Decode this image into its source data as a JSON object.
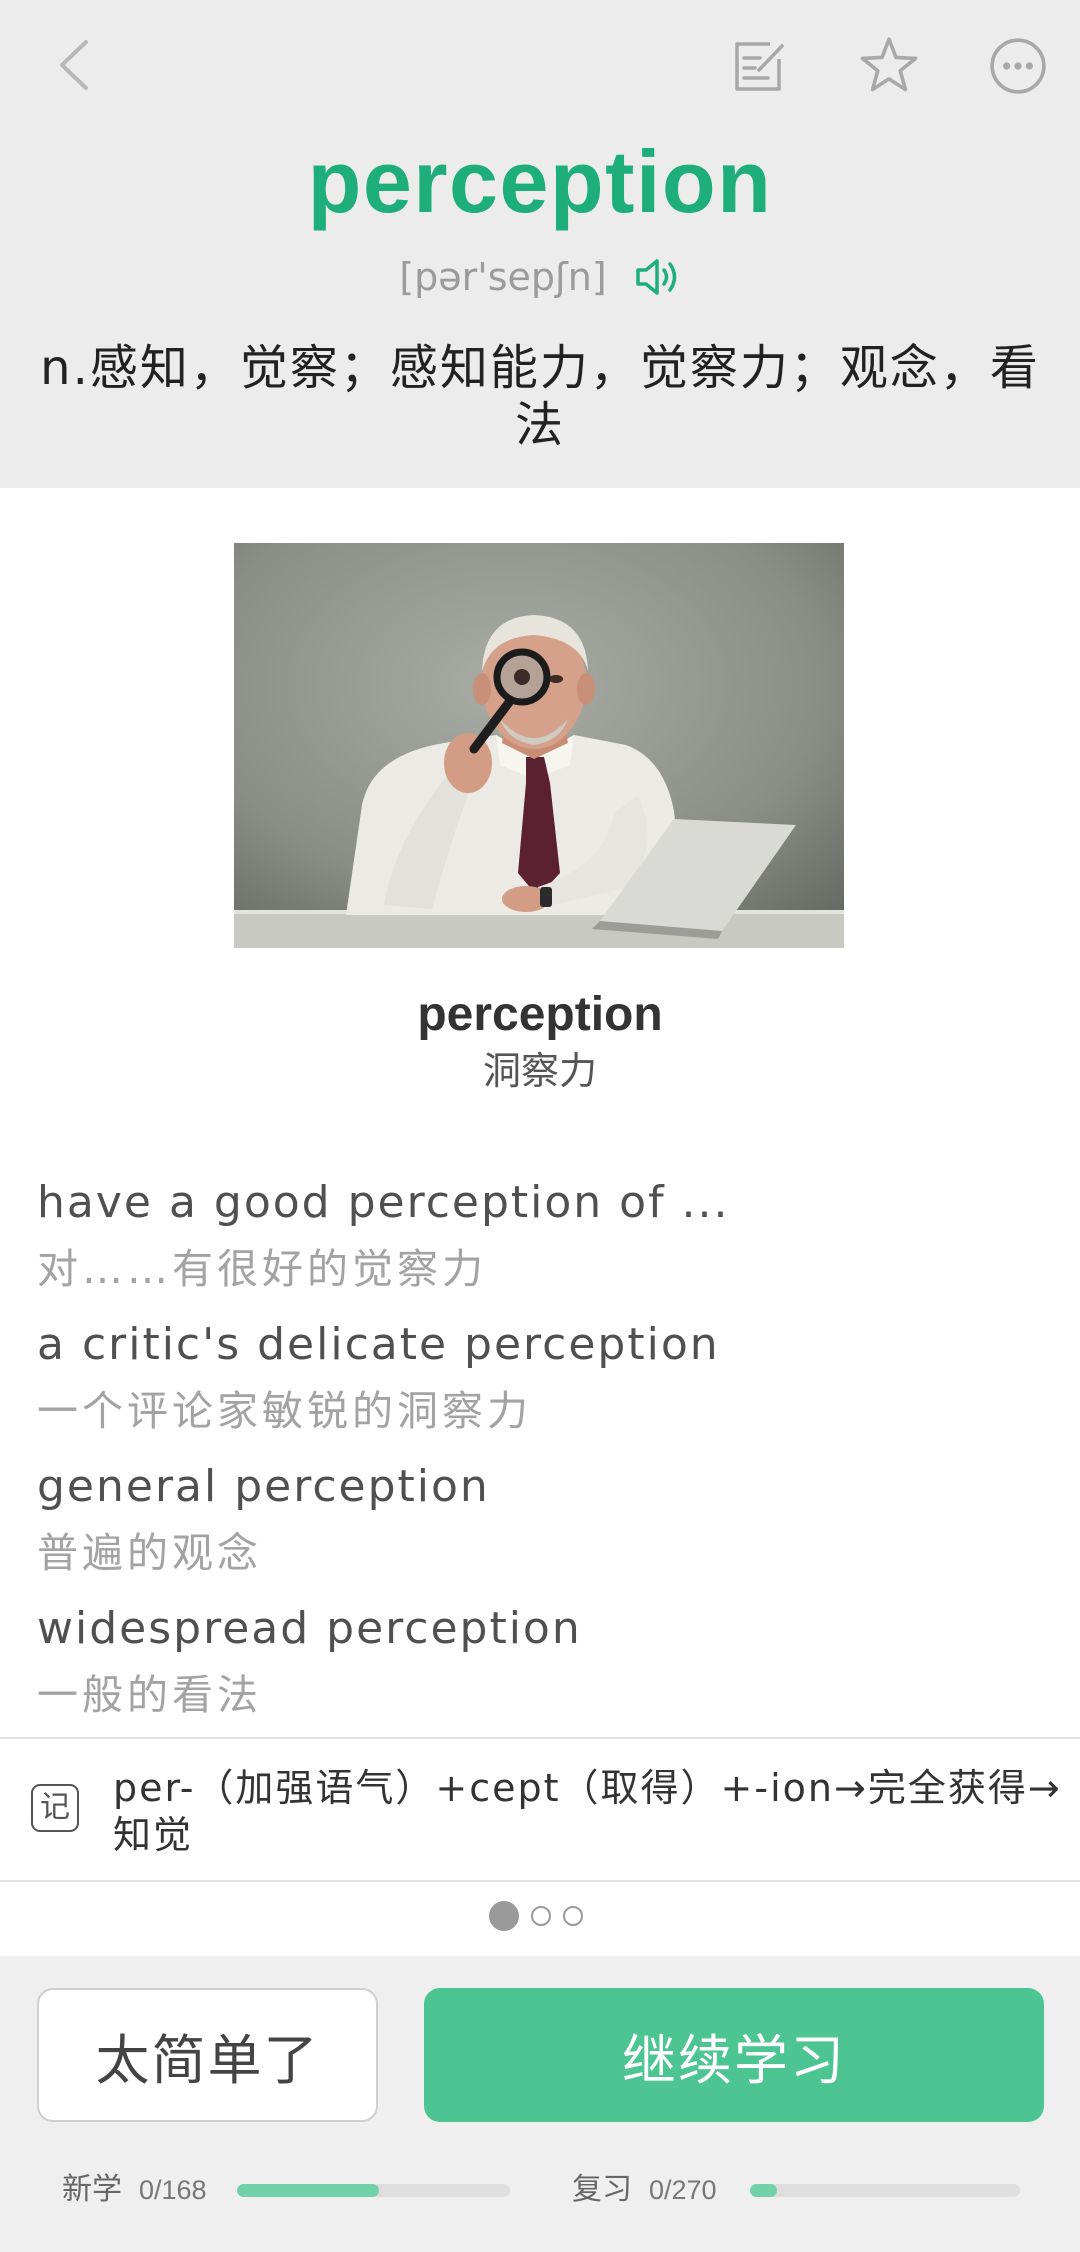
{
  "colors": {
    "accent": "#1dae7b",
    "button_green": "#4cc592",
    "progress_fill": "#72d0ab",
    "header_bg": "#ececec",
    "footer_bg": "#efefef"
  },
  "icons": {
    "back": "chevron-left-icon",
    "notes": "edit-note-icon",
    "favorite": "star-icon",
    "more": "more-options-icon",
    "audio": "speaker-icon",
    "memory_tip": "memory-tip-icon"
  },
  "word": {
    "title": "perception",
    "phonetic": "[pər'sepʃn]",
    "definition": "n.感知，觉察；感知能力，觉察力；观念，看法"
  },
  "image_card": {
    "caption_word": "perception",
    "caption_meaning": "洞察力"
  },
  "phrases": [
    {
      "en": "have a good perception of ...",
      "zh": "对……有很好的觉察力"
    },
    {
      "en": "a critic's delicate perception",
      "zh": "一个评论家敏锐的洞察力"
    },
    {
      "en": "general perception",
      "zh": "普遍的观念"
    },
    {
      "en": "widespread perception",
      "zh": "一般的看法"
    }
  ],
  "memory_tip": {
    "badge": "记",
    "lines": [
      "per-（加强语气）+cept（取得）+-ion→完全获得→",
      "知觉"
    ]
  },
  "pagination": {
    "total": 3,
    "active": 1
  },
  "actions": {
    "too_easy_label": "太简单了",
    "continue_label": "继续学习"
  },
  "progress": {
    "new": {
      "label": "新学",
      "count": "0/168",
      "fill": 0.52
    },
    "review": {
      "label": "复习",
      "count": "0/270",
      "fill": 0.1
    }
  }
}
